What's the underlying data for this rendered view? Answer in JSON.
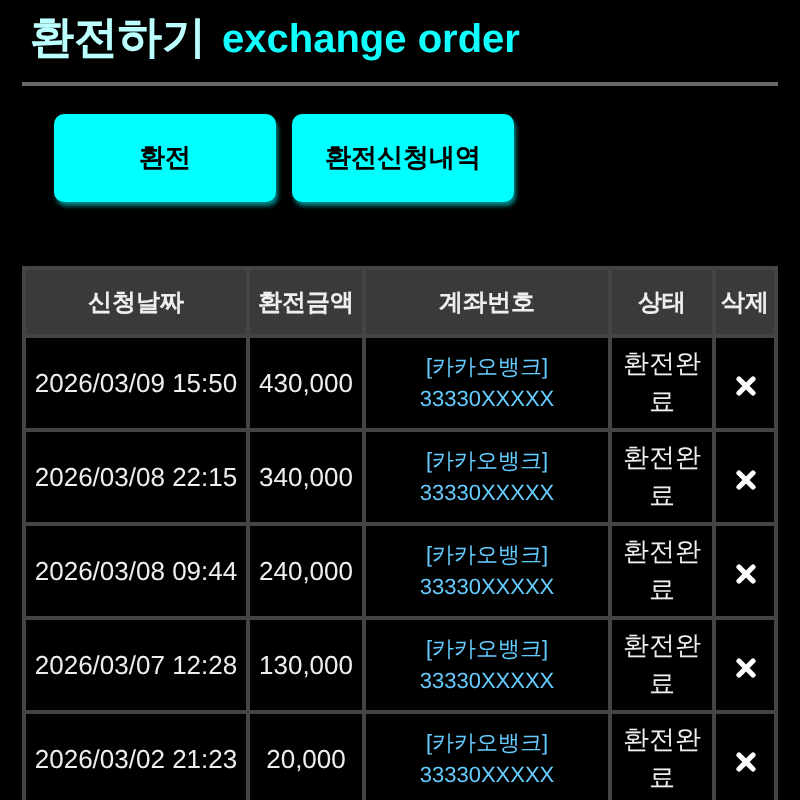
{
  "header": {
    "title": "환전하기",
    "subtitle": "exchange order"
  },
  "buttons": [
    {
      "label": "환전"
    },
    {
      "label": "환전신청내역"
    }
  ],
  "table": {
    "columns": [
      "신청날짜",
      "환전금액",
      "계좌번호",
      "상태",
      "삭제"
    ],
    "rows": [
      {
        "date": "2026/03/09 15:50",
        "amount": "430,000",
        "bank": "[카카오뱅크]",
        "account": "33330XXXXX",
        "status": "환전완료"
      },
      {
        "date": "2026/03/08 22:15",
        "amount": "340,000",
        "bank": "[카카오뱅크]",
        "account": "33330XXXXX",
        "status": "환전완료"
      },
      {
        "date": "2026/03/08 09:44",
        "amount": "240,000",
        "bank": "[카카오뱅크]",
        "account": "33330XXXXX",
        "status": "환전완료"
      },
      {
        "date": "2026/03/07 12:28",
        "amount": "130,000",
        "bank": "[카카오뱅크]",
        "account": "33330XXXXX",
        "status": "환전완료"
      },
      {
        "date": "2026/03/02 21:23",
        "amount": "20,000",
        "bank": "[카카오뱅크]",
        "account": "33330XXXXX",
        "status": "환전완료"
      }
    ]
  }
}
